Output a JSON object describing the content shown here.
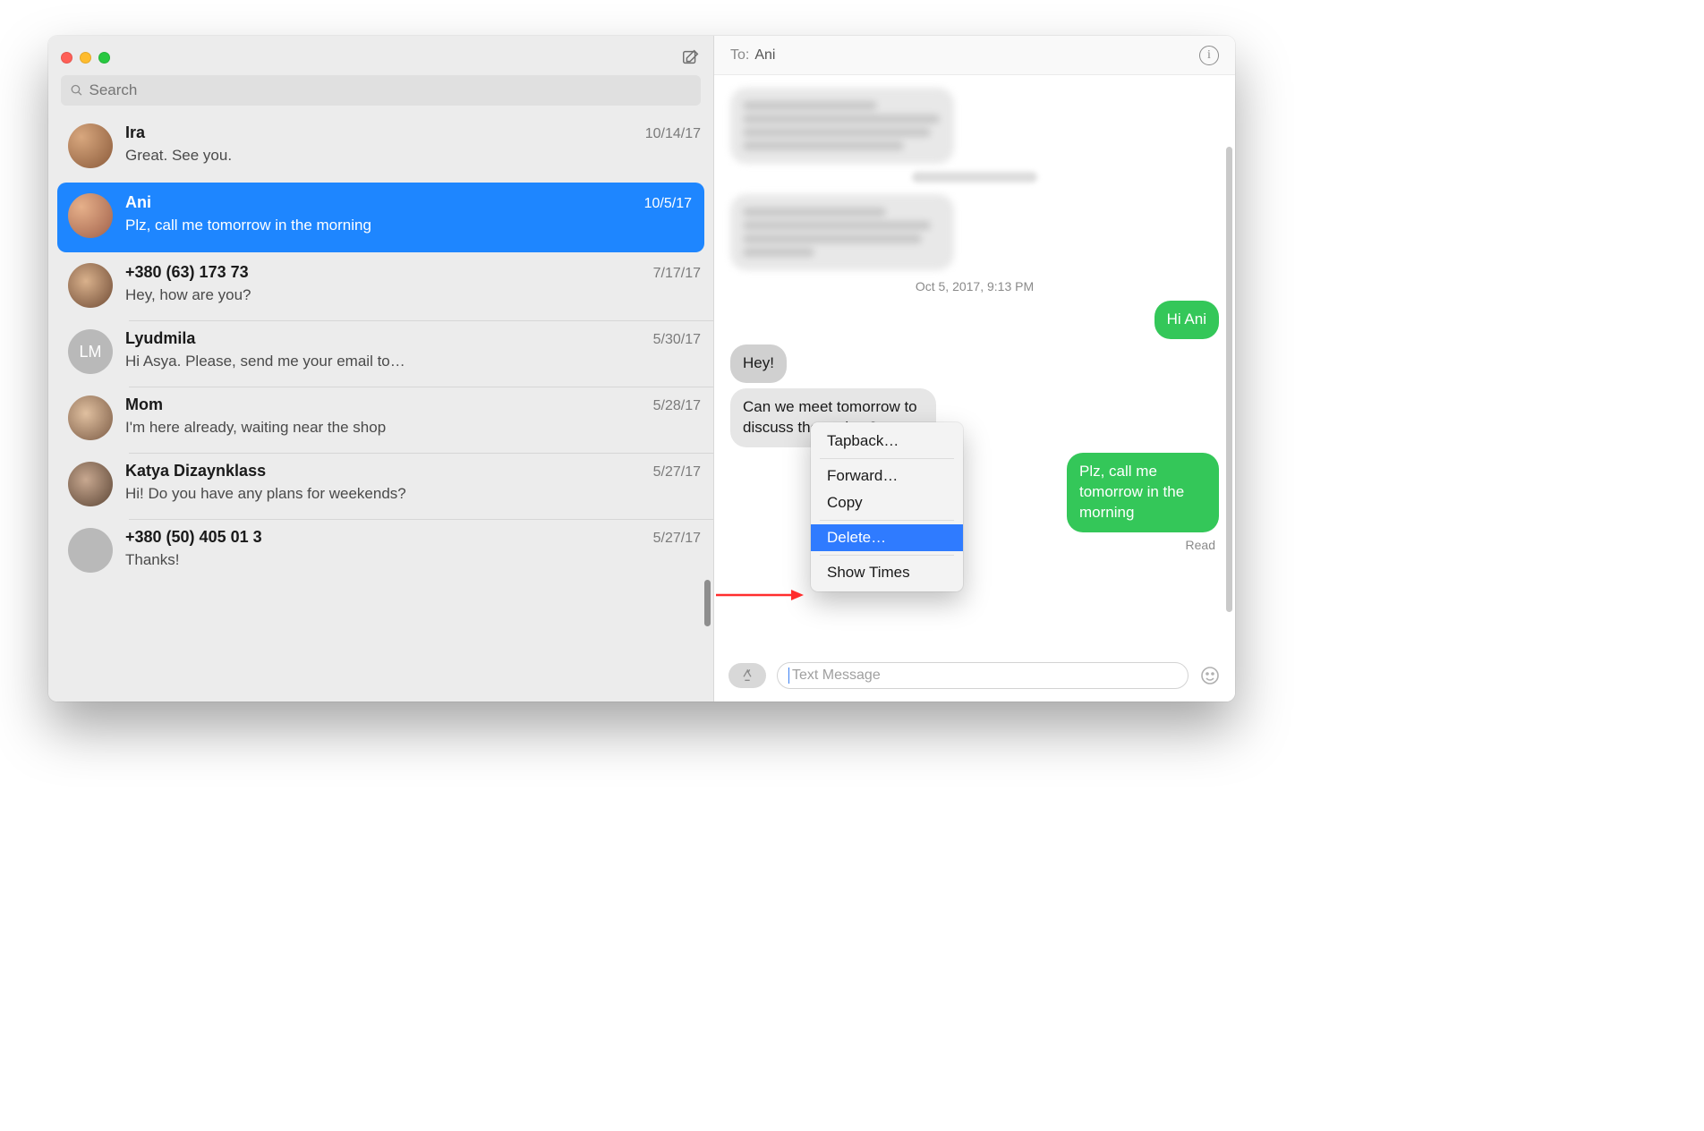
{
  "search": {
    "placeholder": "Search"
  },
  "conversations": [
    {
      "name": "Ira",
      "date": "10/14/17",
      "preview": "Great. See you."
    },
    {
      "name": "Ani",
      "date": "10/5/17",
      "preview": "Plz, call me tomorrow in the morning"
    },
    {
      "name": "+380 (63) 173 73",
      "date": "7/17/17",
      "preview": "Hey, how are you?"
    },
    {
      "name": "Lyudmila",
      "date": "5/30/17",
      "preview": "Hi Asya. Please, send me your email to…",
      "initials": "LM"
    },
    {
      "name": "Mom",
      "date": "5/28/17",
      "preview": "I'm here already, waiting near the shop"
    },
    {
      "name": "Katya Dizaynklass",
      "date": "5/27/17",
      "preview": "Hi! Do you have any plans for weekends?"
    },
    {
      "name": "+380 (50) 405 01 3",
      "date": "5/27/17",
      "preview": "Thanks!"
    }
  ],
  "selected_conversation_index": 1,
  "header": {
    "to_label": "To:",
    "to_name": "Ani"
  },
  "thread": {
    "timestamp": "Oct 5, 2017, 9:13 PM",
    "out1": "Hi Ani",
    "in1": "Hey!",
    "in2": "Can we meet tomorrow to discuss the project?",
    "out2": "Plz, call me tomorrow in the morning",
    "read_receipt": "Read"
  },
  "input": {
    "placeholder": "Text Message"
  },
  "context_menu": {
    "tapback": "Tapback…",
    "forward": "Forward…",
    "copy": "Copy",
    "delete": "Delete…",
    "show_times": "Show Times"
  }
}
